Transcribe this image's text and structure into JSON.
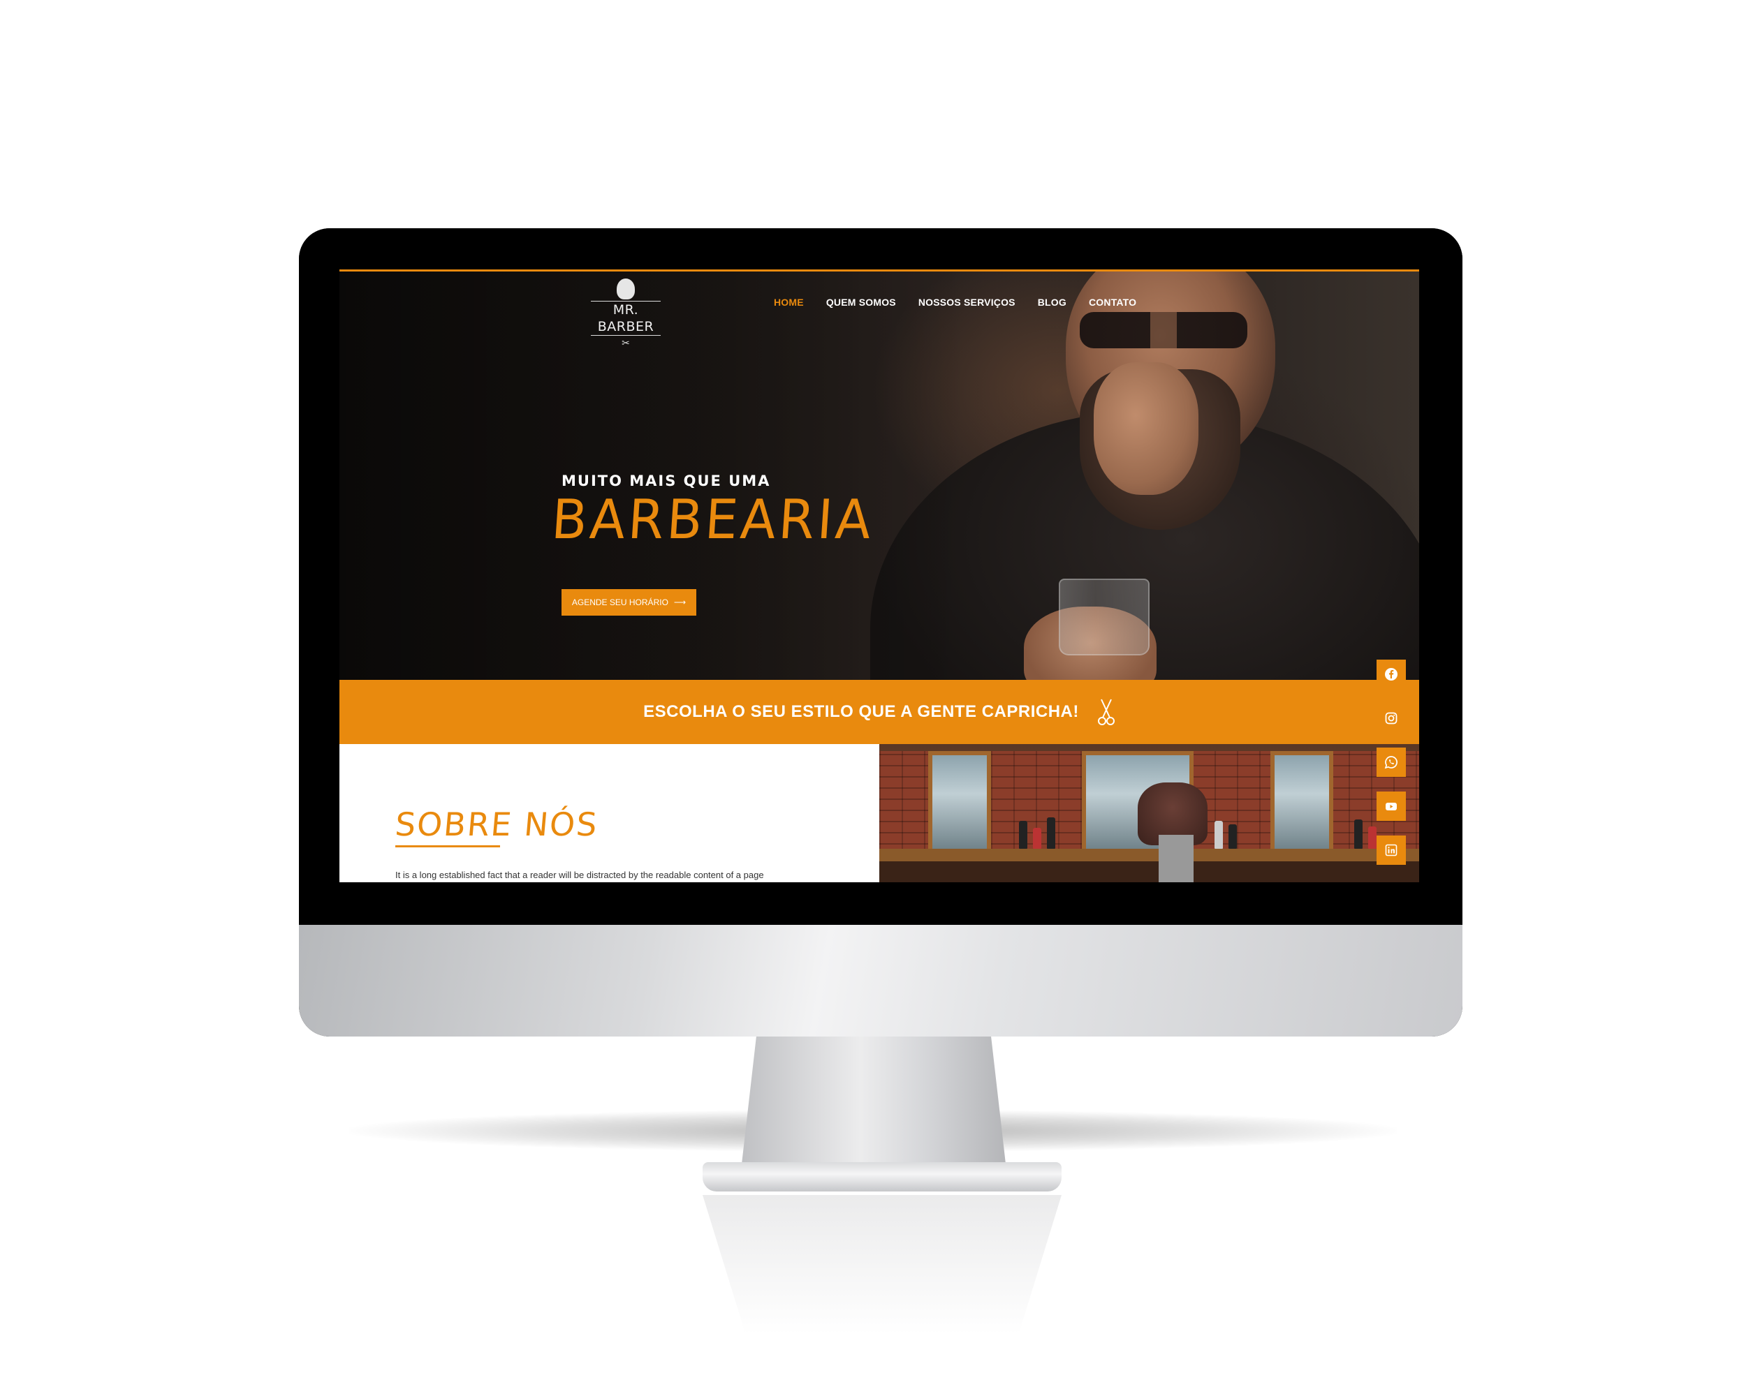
{
  "colors": {
    "accent": "#e98a0e",
    "hero_bg": "#1a1512",
    "monitor_bezel": "#000000"
  },
  "header": {
    "logo_text": "MR. BARBER",
    "nav": [
      {
        "label": "HOME",
        "active": true
      },
      {
        "label": "QUEM SOMOS",
        "active": false
      },
      {
        "label": "NOSSOS SERVIÇOS",
        "active": false
      },
      {
        "label": "BLOG",
        "active": false
      },
      {
        "label": "CONTATO",
        "active": false
      }
    ]
  },
  "hero": {
    "subtitle": "MUITO MAIS QUE UMA",
    "title": "BARBEARIA",
    "cta_label": "AGENDE SEU HORÁRIO"
  },
  "strip": {
    "text": "ESCOLHA O SEU ESTILO QUE A GENTE CAPRICHA!",
    "icon": "scissors-icon"
  },
  "about": {
    "title": "SOBRE NÓS",
    "text": "It is a long established fact that a reader will be distracted by the readable content of a page"
  },
  "social": [
    {
      "icon": "facebook-icon"
    },
    {
      "icon": "instagram-icon"
    },
    {
      "icon": "whatsapp-icon"
    },
    {
      "icon": "youtube-icon"
    },
    {
      "icon": "linkedin-icon"
    }
  ]
}
